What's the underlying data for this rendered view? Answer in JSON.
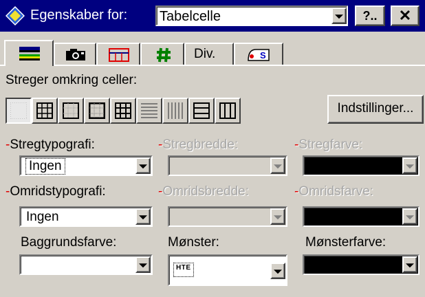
{
  "titlebar": {
    "title": "Egenskaber for:",
    "object_type": "Tabelcelle",
    "help_label": "?..",
    "close_label": "✕"
  },
  "tabs": [
    {
      "id": "borders",
      "icon": "borders-icon",
      "active": true
    },
    {
      "id": "image",
      "icon": "camera-icon"
    },
    {
      "id": "table",
      "icon": "table-icon"
    },
    {
      "id": "cell",
      "icon": "hash-icon"
    },
    {
      "id": "misc",
      "label": "Div."
    },
    {
      "id": "script",
      "icon": "script-icon"
    }
  ],
  "borders": {
    "section_label": "Streger omkring celler:",
    "settings_label": "Indstillinger..."
  },
  "fields": {
    "stroke_type": {
      "label": "Stregtypografi:",
      "value": "Ingen"
    },
    "stroke_width": {
      "label": "Stregbredde:",
      "value": ""
    },
    "stroke_color": {
      "label": "Stregfarve:",
      "value": "#000000"
    },
    "outline_type": {
      "label": "Omridstypografi:",
      "value": "Ingen"
    },
    "outline_width": {
      "label": "Omridsbredde:",
      "value": ""
    },
    "outline_color": {
      "label": "Omridsfarve:",
      "value": "#000000"
    },
    "bg_color": {
      "label": "Baggrundsfarve:",
      "value": "#ffffff"
    },
    "pattern": {
      "label": "Mønster:",
      "value": "hte"
    },
    "pattern_color": {
      "label": "Mønsterfarve:",
      "value": "#000000"
    }
  },
  "required_marker": "-"
}
